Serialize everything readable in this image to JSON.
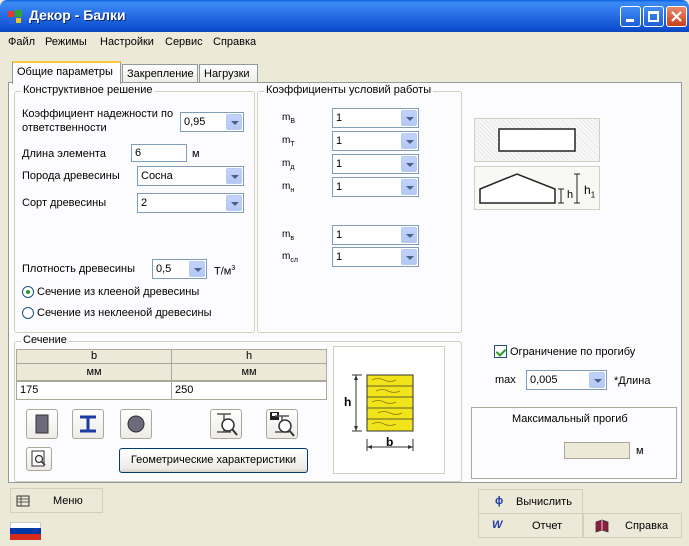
{
  "window": {
    "title": "Декор - Балки"
  },
  "menu": [
    "Файл",
    "Режимы",
    "Настройки",
    "Сервис",
    "Справка"
  ],
  "tabs": [
    "Общие параметры",
    "Закрепление",
    "Нагрузки"
  ],
  "construct": {
    "title": "Конструктивное решение",
    "reliability_label_1": "Коэффициент надежности по",
    "reliability_label_2": "ответственности",
    "reliability_value": "0,95",
    "length_label": "Длина элемента",
    "length_value": "6",
    "length_unit": "м",
    "species_label": "Порода древесины",
    "species_value": "Сосна",
    "grade_label": "Сорт древесины",
    "grade_value": "2",
    "density_label": "Плотность древесины",
    "density_value": "0,5",
    "density_unit": "Т/м",
    "density_unit_sup": "3",
    "radio_glued": "Сечение из клееной древесины",
    "radio_unglued": "Сечение из неклееной древесины"
  },
  "coeffs": {
    "title": "Коэффициенты условий работы",
    "items": [
      {
        "label": "m",
        "sub": "В",
        "value": "1"
      },
      {
        "label": "m",
        "sub": "Т",
        "value": "1"
      },
      {
        "label": "m",
        "sub": "д",
        "value": "1"
      },
      {
        "label": "m",
        "sub": "н",
        "value": "1"
      },
      {
        "label": "m",
        "sub": "в",
        "value": "1"
      },
      {
        "label": "m",
        "sub": "сл",
        "value": "1"
      }
    ]
  },
  "section": {
    "title": "Сечение",
    "col_b": "b",
    "col_h": "h",
    "unit_b": "мм",
    "unit_h": "мм",
    "value_b": "175",
    "value_h": "250",
    "geom_button": "Геометрические характеристики",
    "drawing_h": "h",
    "drawing_b": "b"
  },
  "beam_icons": {
    "h_label": "h",
    "h1_label": "h",
    "h1_sub": "1"
  },
  "deflection": {
    "check_label": "Ограничение по прогибу",
    "max_label": "max",
    "max_value": "0,005",
    "per_length": "*Длина",
    "box_title": "Максимальный прогиб",
    "unit": "м"
  },
  "bottom": {
    "menu_button": "Меню",
    "calc_button": "Вычислить",
    "report_button": "Отчет",
    "help_button": "Справка"
  },
  "colors": {
    "wood": "#F2E41A",
    "accent": "#0A5FE0",
    "flag_white": "#FFFFFF",
    "flag_blue": "#0039A6",
    "flag_red": "#D52B1E"
  }
}
